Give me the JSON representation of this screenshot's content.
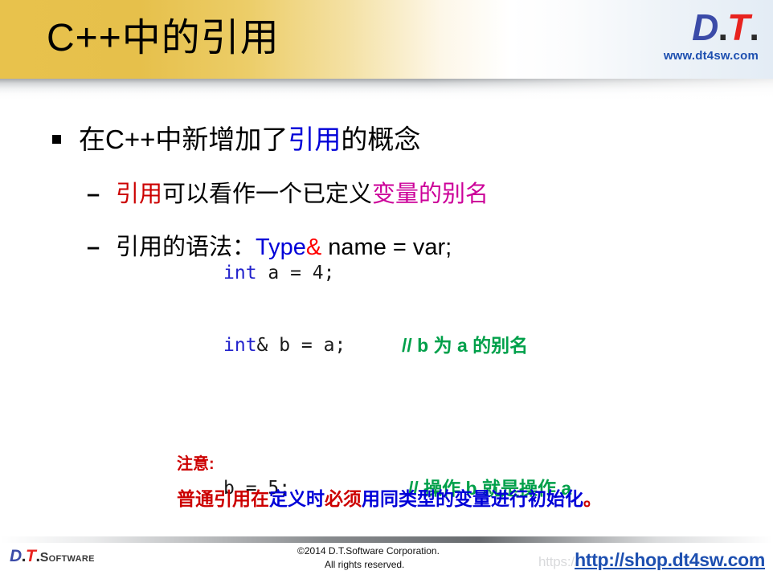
{
  "header": {
    "title": "C++中的引用",
    "logo": {
      "d": "D",
      "dot1": ".",
      "t": "T",
      "dot2": ".",
      "url": "www.dt4sw.com"
    }
  },
  "body": {
    "bullet1": {
      "marker": "square-bullet",
      "part1": "在C++中新增加了",
      "highlight": "引用",
      "part2": "的概念"
    },
    "bullet2": {
      "marker": "–",
      "part1": "引用",
      "part2": "可以看作一个已定义",
      "part3": "变量",
      "part4": "的别名"
    },
    "bullet3": {
      "marker": "–",
      "part1": "引用的语法：",
      "type": "Type",
      "amp": "&",
      "rest": " name = var;"
    }
  },
  "code": {
    "line1": {
      "keyword": "int",
      "rest": " a = 4;",
      "comment": ""
    },
    "line2": {
      "keyword": "int",
      "rest": "& b = a;",
      "comment": "// b 为 a 的别名"
    },
    "line3": {
      "keyword": "",
      "rest": "b = 5;",
      "comment": "// 操作 b 就是操作 a"
    }
  },
  "note": {
    "title": "注意:",
    "seg1": "普通引用在",
    "seg2": "定义时",
    "seg3": "必须",
    "seg4": "用同类型的变量进行初始化",
    "seg5": "。"
  },
  "footer": {
    "logo": {
      "d": "D",
      "dot1": ".",
      "t": "T",
      "dot2": ".",
      "word": "Software"
    },
    "copyright_line1": "©2014 D.T.Software Corporation.",
    "copyright_line2": "All rights reserved.",
    "watermark": "https://",
    "link": "http://shop.dt4sw.com"
  },
  "colors": {
    "gold": "#e8c24c",
    "blue": "#0000d8",
    "red": "#cc0000",
    "magenta": "#cc0099",
    "green": "#00a04a",
    "logo_blue": "#3b4ba8",
    "logo_red": "#e8231f",
    "link_blue": "#1d4fb0"
  }
}
